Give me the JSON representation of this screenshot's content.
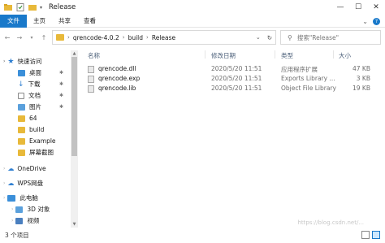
{
  "window": {
    "title": "Release",
    "controls": [
      "—",
      "☐",
      "✕"
    ]
  },
  "ribbon": {
    "tabs": [
      "文件",
      "主页",
      "共享",
      "查看"
    ]
  },
  "address": {
    "crumbs": [
      "qrencode-4.0.2",
      "build",
      "Release"
    ]
  },
  "search": {
    "placeholder": "搜索\"Release\""
  },
  "sidebar": {
    "items": [
      {
        "label": "快速访问",
        "icon": "star-icon",
        "pinned": false
      },
      {
        "label": "桌面",
        "icon": "desktop-icon",
        "pinned": true
      },
      {
        "label": "下载",
        "icon": "download-icon",
        "pinned": true
      },
      {
        "label": "文档",
        "icon": "document-icon",
        "pinned": true
      },
      {
        "label": "图片",
        "icon": "picture-icon",
        "pinned": true
      },
      {
        "label": "64",
        "icon": "folder-icon",
        "pinned": false
      },
      {
        "label": "build",
        "icon": "folder-icon",
        "pinned": false
      },
      {
        "label": "Example",
        "icon": "folder-icon",
        "pinned": false
      },
      {
        "label": "屏幕截图",
        "icon": "folder-icon",
        "pinned": false
      },
      {
        "label": "OneDrive",
        "icon": "cloud-icon",
        "pinned": false
      },
      {
        "label": "WPS网盘",
        "icon": "wps-cloud-icon",
        "pinned": false
      },
      {
        "label": "此电脑",
        "icon": "computer-icon",
        "pinned": false
      },
      {
        "label": "3D 对象",
        "icon": "3d-objects-icon",
        "pinned": false
      },
      {
        "label": "视频",
        "icon": "video-icon",
        "pinned": false
      }
    ]
  },
  "columns": {
    "name": "名称",
    "date": "修改日期",
    "type": "类型",
    "size": "大小"
  },
  "files": [
    {
      "name": "qrencode.dll",
      "date": "2020/5/20 11:51",
      "type": "应用程序扩展",
      "size": "47 KB"
    },
    {
      "name": "qrencode.exp",
      "date": "2020/5/20 11:51",
      "type": "Exports Library ...",
      "size": "3 KB"
    },
    {
      "name": "qrencode.lib",
      "date": "2020/5/20 11:51",
      "type": "Object File Library",
      "size": "19 KB"
    }
  ],
  "status": {
    "count": "3 个项目"
  },
  "watermark": "https://blog.csdn.net/..."
}
